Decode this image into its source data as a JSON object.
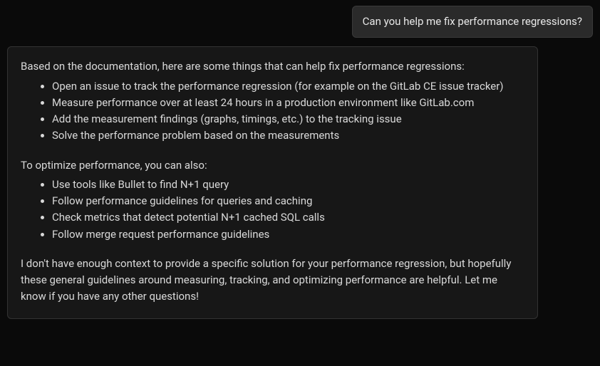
{
  "user_message": "Can you help me fix performance regressions?",
  "assistant": {
    "intro1": "Based on the documentation, here are some things that can help fix performance regressions:",
    "list1": [
      "Open an issue to track the performance regression (for example on the GitLab CE issue tracker)",
      "Measure performance over at least 24 hours in a production environment like GitLab.com",
      "Add the measurement findings (graphs, timings, etc.) to the tracking issue",
      "Solve the performance problem based on the measurements"
    ],
    "intro2": "To optimize performance, you can also:",
    "list2": [
      "Use tools like Bullet to find N+1 query",
      "Follow performance guidelines for queries and caching",
      "Check metrics that detect potential N+1 cached SQL calls",
      "Follow merge request performance guidelines"
    ],
    "outro": "I don't have enough context to provide a specific solution for your performance regression, but hopefully these general guidelines around measuring, tracking, and optimizing performance are helpful. Let me know if you have any other questions!"
  }
}
